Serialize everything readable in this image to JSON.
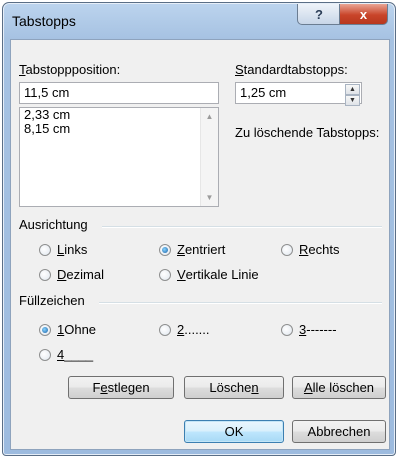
{
  "window": {
    "title": "Tabstopps"
  },
  "titlebar": {
    "help_glyph": "?",
    "close_glyph": "x"
  },
  "tabposition": {
    "label_u": "T",
    "label_rest": "abstoppposition:",
    "value": "11,5 cm",
    "list": [
      "2,33 cm",
      "8,15 cm"
    ]
  },
  "standard": {
    "label_u": "S",
    "label_rest": "tandardtabstopps:",
    "value": "1,25 cm"
  },
  "delete_label": "Zu löschende Tabstopps:",
  "alignment": {
    "title": "Ausrichtung",
    "options": [
      {
        "u": "L",
        "rest": "inks",
        "selected": false
      },
      {
        "u": "Z",
        "rest": "entriert",
        "selected": true
      },
      {
        "u": "R",
        "rest": "echts",
        "selected": false
      },
      {
        "u": "D",
        "rest": "ezimal",
        "selected": false
      },
      {
        "u": "V",
        "rest": "ertikale Linie",
        "selected": false
      }
    ]
  },
  "leader": {
    "title": "Füllzeichen",
    "options": [
      {
        "u": "1",
        "rest": " Ohne",
        "selected": true
      },
      {
        "u": "2",
        "rest": " .......",
        "selected": false
      },
      {
        "u": "3",
        "rest": " -------",
        "selected": false
      },
      {
        "u": "4",
        "rest": " ____",
        "selected": false
      }
    ]
  },
  "buttons": {
    "set": {
      "pre": "F",
      "u": "e",
      "post": "stlegen"
    },
    "clear": {
      "pre": "Lösche",
      "u": "n",
      "post": ""
    },
    "clear_all": {
      "pre": "",
      "u": "A",
      "post": "lle löschen"
    },
    "ok": "OK",
    "cancel": "Abbrechen"
  }
}
